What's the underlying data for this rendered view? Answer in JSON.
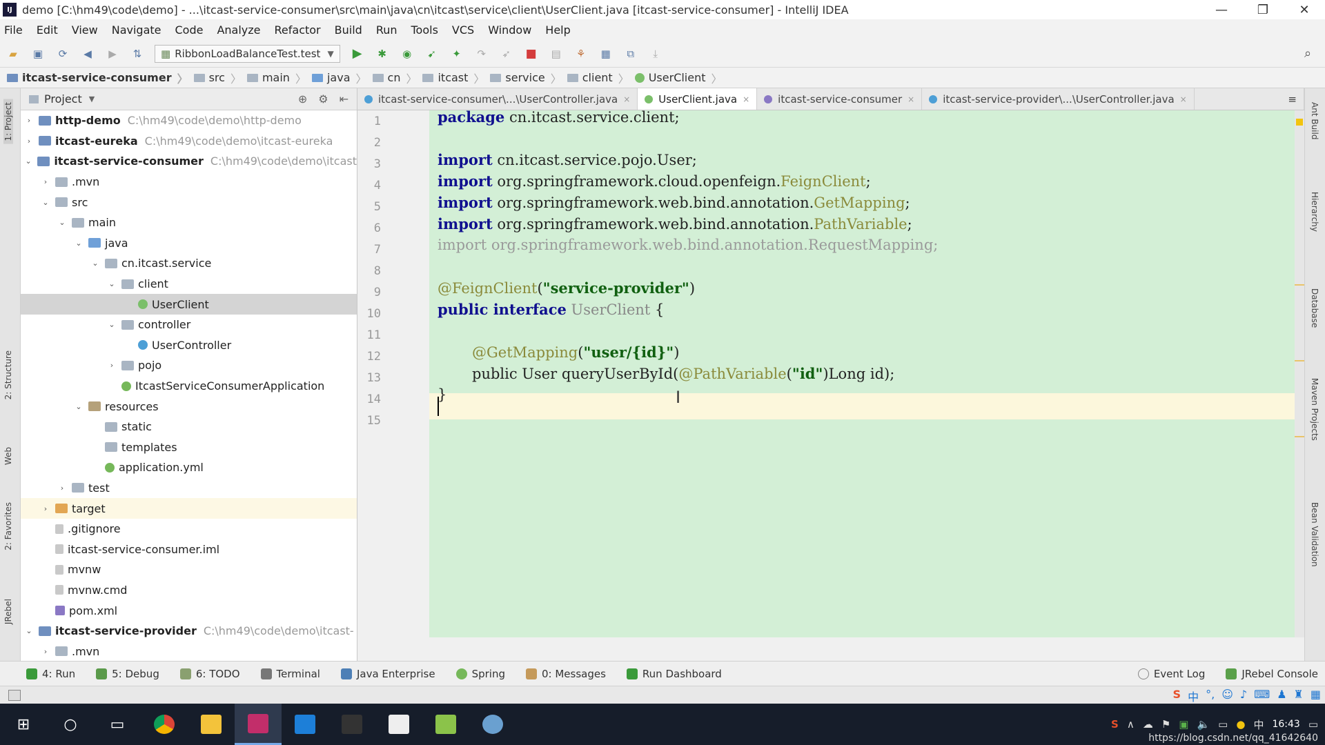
{
  "window": {
    "title": "demo [C:\\hm49\\code\\demo] - ...\\itcast-service-consumer\\src\\main\\java\\cn\\itcast\\service\\client\\UserClient.java [itcast-service-consumer] - IntelliJ IDEA",
    "minimize": "—",
    "restore": "❐",
    "close": "✕"
  },
  "menu": [
    "File",
    "Edit",
    "View",
    "Navigate",
    "Code",
    "Analyze",
    "Refactor",
    "Build",
    "Run",
    "Tools",
    "VCS",
    "Window",
    "Help"
  ],
  "toolbar": {
    "run_config": "RibbonLoadBalanceTest.test"
  },
  "breadcrumbs": [
    "itcast-service-consumer",
    "src",
    "main",
    "java",
    "cn",
    "itcast",
    "service",
    "client",
    "UserClient"
  ],
  "project_panel": {
    "title": "Project",
    "tree": [
      {
        "label": "http-demo",
        "path": "C:\\hm49\\code\\demo\\http-demo",
        "indent": 0,
        "arrow": "›",
        "icon": "module",
        "bold": true
      },
      {
        "label": "itcast-eureka",
        "path": "C:\\hm49\\code\\demo\\itcast-eureka",
        "indent": 0,
        "arrow": "›",
        "icon": "module",
        "bold": true
      },
      {
        "label": "itcast-service-consumer",
        "path": "C:\\hm49\\code\\demo\\itcast",
        "indent": 0,
        "arrow": "⌄",
        "icon": "module",
        "bold": true
      },
      {
        "label": ".mvn",
        "path": "",
        "indent": 1,
        "arrow": "›",
        "icon": "folder"
      },
      {
        "label": "src",
        "path": "",
        "indent": 1,
        "arrow": "⌄",
        "icon": "folder"
      },
      {
        "label": "main",
        "path": "",
        "indent": 2,
        "arrow": "⌄",
        "icon": "folder"
      },
      {
        "label": "java",
        "path": "",
        "indent": 3,
        "arrow": "⌄",
        "icon": "src"
      },
      {
        "label": "cn.itcast.service",
        "path": "",
        "indent": 4,
        "arrow": "⌄",
        "icon": "folder"
      },
      {
        "label": "client",
        "path": "",
        "indent": 5,
        "arrow": "⌄",
        "icon": "folder"
      },
      {
        "label": "UserClient",
        "path": "",
        "indent": 6,
        "arrow": "",
        "icon": "interface",
        "selected": true
      },
      {
        "label": "controller",
        "path": "",
        "indent": 5,
        "arrow": "⌄",
        "icon": "folder"
      },
      {
        "label": "UserController",
        "path": "",
        "indent": 6,
        "arrow": "",
        "icon": "class"
      },
      {
        "label": "pojo",
        "path": "",
        "indent": 5,
        "arrow": "›",
        "icon": "folder"
      },
      {
        "label": "ItcastServiceConsumerApplication",
        "path": "",
        "indent": 5,
        "arrow": "",
        "icon": "spring"
      },
      {
        "label": "resources",
        "path": "",
        "indent": 3,
        "arrow": "⌄",
        "icon": "res"
      },
      {
        "label": "static",
        "path": "",
        "indent": 4,
        "arrow": "",
        "icon": "folder"
      },
      {
        "label": "templates",
        "path": "",
        "indent": 4,
        "arrow": "",
        "icon": "folder"
      },
      {
        "label": "application.yml",
        "path": "",
        "indent": 4,
        "arrow": "",
        "icon": "spring"
      },
      {
        "label": "test",
        "path": "",
        "indent": 2,
        "arrow": "›",
        "icon": "folder"
      },
      {
        "label": "target",
        "path": "",
        "indent": 1,
        "arrow": "›",
        "icon": "target",
        "target": true
      },
      {
        "label": ".gitignore",
        "path": "",
        "indent": 1,
        "arrow": "",
        "icon": "file"
      },
      {
        "label": "itcast-service-consumer.iml",
        "path": "",
        "indent": 1,
        "arrow": "",
        "icon": "file"
      },
      {
        "label": "mvnw",
        "path": "",
        "indent": 1,
        "arrow": "",
        "icon": "file"
      },
      {
        "label": "mvnw.cmd",
        "path": "",
        "indent": 1,
        "arrow": "",
        "icon": "file"
      },
      {
        "label": "pom.xml",
        "path": "",
        "indent": 1,
        "arrow": "",
        "icon": "maven"
      },
      {
        "label": "itcast-service-provider",
        "path": "C:\\hm49\\code\\demo\\itcast-",
        "indent": 0,
        "arrow": "⌄",
        "icon": "module",
        "bold": true
      },
      {
        "label": ".mvn",
        "path": "",
        "indent": 1,
        "arrow": "›",
        "icon": "folder"
      }
    ]
  },
  "editor_tabs": [
    {
      "label": "itcast-service-consumer\\...\\UserController.java",
      "active": false,
      "color": "#4d9fd6"
    },
    {
      "label": "UserClient.java",
      "active": true,
      "color": "#7bbf6a"
    },
    {
      "label": "itcast-service-consumer",
      "active": false,
      "color": "#8a78c4"
    },
    {
      "label": "itcast-service-provider\\...\\UserController.java",
      "active": false,
      "color": "#4d9fd6"
    }
  ],
  "code": {
    "lines": [
      "1",
      "2",
      "3",
      "4",
      "5",
      "6",
      "7",
      "8",
      "9",
      "10",
      "11",
      "12",
      "13",
      "14",
      "15"
    ],
    "l1": {
      "kw": "package",
      "rest": " cn.itcast.service.client;"
    },
    "l3": {
      "kw": "import",
      "rest": " cn.itcast.service.pojo.User;"
    },
    "l4": {
      "kw": "import",
      "rest": " org.springframework.cloud.openfeign.",
      "cls": "FeignClient",
      "end": ";"
    },
    "l5": {
      "kw": "import",
      "rest": " org.springframework.web.bind.annotation.",
      "cls": "GetMapping",
      "end": ";"
    },
    "l6": {
      "kw": "import",
      "rest": " org.springframework.web.bind.annotation.",
      "cls": "PathVariable",
      "end": ";"
    },
    "l7": {
      "text": "import org.springframework.web.bind.annotation.RequestMapping;"
    },
    "l9": {
      "ann": "@FeignClient",
      "open": "(",
      "str": "\"service-provider\"",
      "close": ")"
    },
    "l10": {
      "kw": "public interface",
      "name": " UserClient",
      "brace": " {"
    },
    "l12": {
      "ann": "@GetMapping",
      "open": "(",
      "str": "\"user/{id}\"",
      "close": ")"
    },
    "l13": {
      "a": "public User queryUserById(",
      "ann": "@PathVariable",
      "b": "(",
      "str": "\"id\"",
      "c": ")Long id);"
    },
    "l14": {
      "text": "}"
    }
  },
  "bottom_tools": {
    "run": "4: Run",
    "debug": "5: Debug",
    "todo": "6: TODO",
    "terminal": "Terminal",
    "java_enterprise": "Java Enterprise",
    "spring": "Spring",
    "messages": "0: Messages",
    "run_dashboard": "Run Dashboard",
    "event_log": "Event Log",
    "jrebel_console": "JRebel Console"
  },
  "side_tabs": {
    "left": [
      "1: Project",
      "2: Structure",
      "Web",
      "2: Favorites",
      "JRebel"
    ],
    "right": [
      "Ant Build",
      "Hierarchy",
      "Database",
      "Maven Projects",
      "Bean Validation"
    ]
  },
  "taskbar": {
    "time": "16:43",
    "watermark": "https://blog.csdn.net/qq_41642640"
  }
}
